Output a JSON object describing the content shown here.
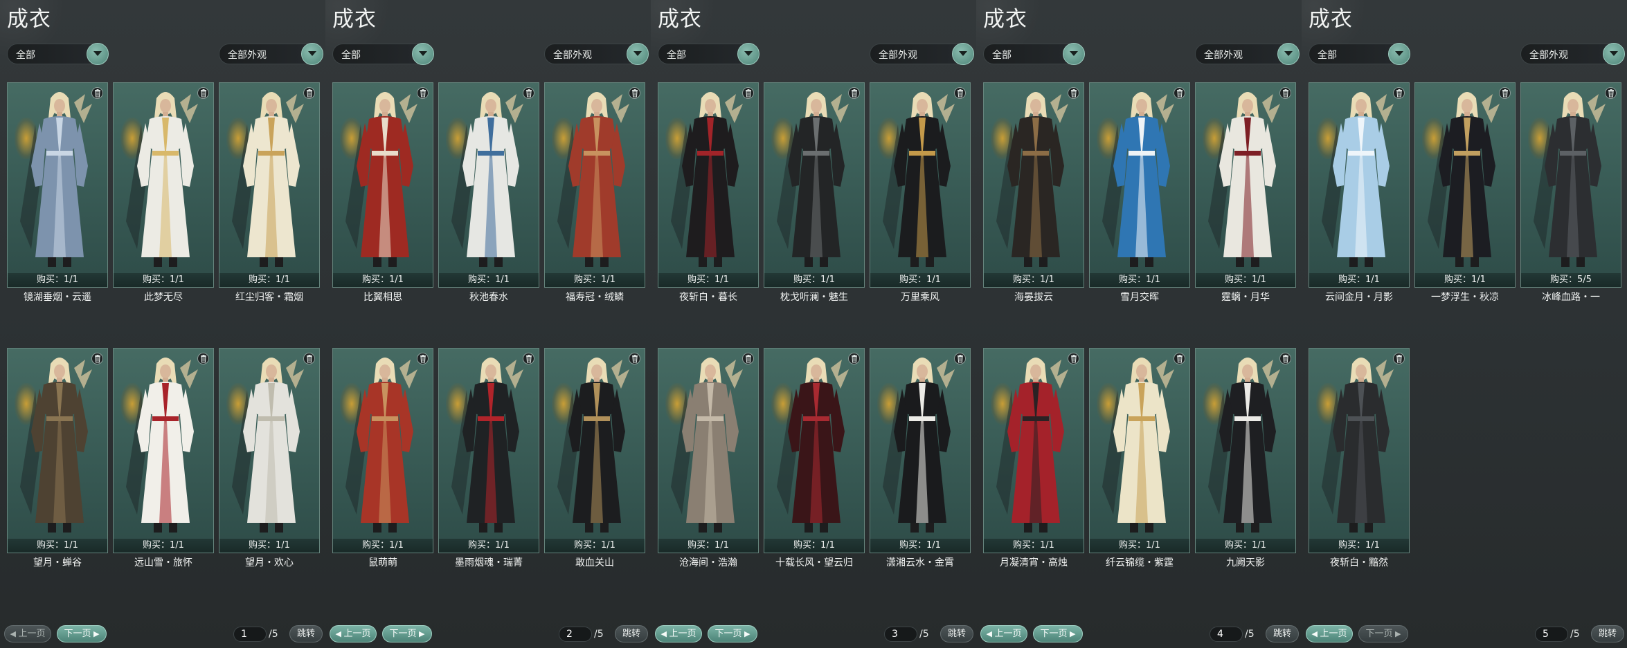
{
  "colors": {
    "accent": "#6aa597",
    "card_bg": "#3a5d57",
    "panel_bg": "#2c3133"
  },
  "panels": [
    {
      "title": "成衣",
      "filter": "全部",
      "appearance": "全部外观",
      "prev": "上一页",
      "next": "下一页",
      "prev_enabled": false,
      "next_enabled": true,
      "page": "1",
      "total": "/5",
      "jump": "跳转",
      "items": [
        {
          "name": "镜湖垂烟・云遥",
          "buy": "购买：1/1",
          "outfit": "#7d93ad",
          "trim": "#c9d6e4"
        },
        {
          "name": "此梦无尽",
          "buy": "购买：1/1",
          "outfit": "#ecebe4",
          "trim": "#d8b86a"
        },
        {
          "name": "红尘归客・霜烟",
          "buy": "购买：1/1",
          "outfit": "#ede6cf",
          "trim": "#c9a35a"
        },
        {
          "name": "望月・蝉谷",
          "buy": "购买：1/1",
          "outfit": "#4e4232",
          "trim": "#8a7552"
        },
        {
          "name": "远山雪・旅怀",
          "buy": "购买：1/1",
          "outfit": "#f1efe9",
          "trim": "#a8232a"
        },
        {
          "name": "望月・欢心",
          "buy": "购买：1/1",
          "outfit": "#e3e2dc",
          "trim": "#bfbcae"
        }
      ]
    },
    {
      "title": "成衣",
      "filter": "全部",
      "appearance": "全部外观",
      "prev": "上一页",
      "next": "下一页",
      "prev_enabled": true,
      "next_enabled": true,
      "page": "2",
      "total": "/5",
      "jump": "跳转",
      "items": [
        {
          "name": "比翼相思",
          "buy": "购买：1/1",
          "outfit": "#9e2a22",
          "trim": "#e8dccb"
        },
        {
          "name": "秋池春水",
          "buy": "购买：1/1",
          "outfit": "#e6e7e3",
          "trim": "#3f6e9c"
        },
        {
          "name": "福寿冠・绒鳞",
          "buy": "购买：1/1",
          "outfit": "#a03b2b",
          "trim": "#c8925f"
        },
        {
          "name": "鼠萌萌",
          "buy": "购买：1/1",
          "outfit": "#a83527",
          "trim": "#c8925f"
        },
        {
          "name": "墨雨烟魂・瑞菁",
          "buy": "购买：1/1",
          "outfit": "#1f2224",
          "trim": "#b0242a"
        },
        {
          "name": "敢血关山",
          "buy": "购买：1/1",
          "outfit": "#1c1d1f",
          "trim": "#b0905a"
        }
      ]
    },
    {
      "title": "成衣",
      "filter": "全部",
      "appearance": "全部外观",
      "prev": "上一页",
      "next": "下一页",
      "prev_enabled": true,
      "next_enabled": true,
      "page": "3",
      "total": "/5",
      "jump": "跳转",
      "items": [
        {
          "name": "夜斩白・暮长",
          "buy": "购买：1/1",
          "outfit": "#1e1c1e",
          "trim": "#a22429"
        },
        {
          "name": "枕戈听澜・魅生",
          "buy": "购买：1/1",
          "outfit": "#232526",
          "trim": "#6b6f70"
        },
        {
          "name": "万里乘风",
          "buy": "购买：1/1",
          "outfit": "#1b1c1e",
          "trim": "#c49a4a"
        },
        {
          "name": "沧海间・浩瀚",
          "buy": "购买：1/1",
          "outfit": "#8a7f72",
          "trim": "#c4b9a8"
        },
        {
          "name": "十载长风・望云归",
          "buy": "购买：1/1",
          "outfit": "#3a1518",
          "trim": "#a82a31"
        },
        {
          "name": "潇湘云水・金霄",
          "buy": "购买：1/1",
          "outfit": "#1a1b1d",
          "trim": "#ecebe6"
        }
      ]
    },
    {
      "title": "成衣",
      "filter": "全部",
      "appearance": "全部外观",
      "prev": "上一页",
      "next": "下一页",
      "prev_enabled": true,
      "next_enabled": true,
      "page": "4",
      "total": "/5",
      "jump": "跳转",
      "items": [
        {
          "name": "海晏拔云",
          "buy": "购买：1/1",
          "outfit": "#2a2623",
          "trim": "#8c6d46"
        },
        {
          "name": "雪月交晖",
          "buy": "购买：1/1",
          "outfit": "#2f76b3",
          "trim": "#eef3f6"
        },
        {
          "name": "霆螭・月华",
          "buy": "购买：1/1",
          "outfit": "#e9e7df",
          "trim": "#7d1f25"
        },
        {
          "name": "月凝清宵・高烛",
          "buy": "购买：1/1",
          "outfit": "#a4222a",
          "trim": "#2a2224"
        },
        {
          "name": "纤云锦缆・紫霆",
          "buy": "购买：1/1",
          "outfit": "#ece4c8",
          "trim": "#c9a35a"
        },
        {
          "name": "九阙天影",
          "buy": "购买：1/1",
          "outfit": "#1e1f22",
          "trim": "#ebeae6"
        }
      ]
    },
    {
      "title": "成衣",
      "filter": "全部",
      "appearance": "全部外观",
      "prev": "上一页",
      "next": "下一页",
      "prev_enabled": true,
      "next_enabled": false,
      "page": "5",
      "total": "/5",
      "jump": "跳转",
      "items": [
        {
          "name": "云间金月・月影",
          "buy": "购买：1/1",
          "outfit": "#a9cde6",
          "trim": "#eef5fa"
        },
        {
          "name": "一梦浮生・秋凉",
          "buy": "购买：1/1",
          "outfit": "#1c1d22",
          "trim": "#c2a060"
        },
        {
          "name": "冰峰血路・一",
          "buy": "购买：5/5",
          "outfit": "#2c2e31",
          "trim": "#5d6165"
        },
        {
          "name": "夜斩白・黯然",
          "buy": "购买：1/1",
          "outfit": "#2a2c2e",
          "trim": "#4d5155"
        }
      ]
    }
  ]
}
